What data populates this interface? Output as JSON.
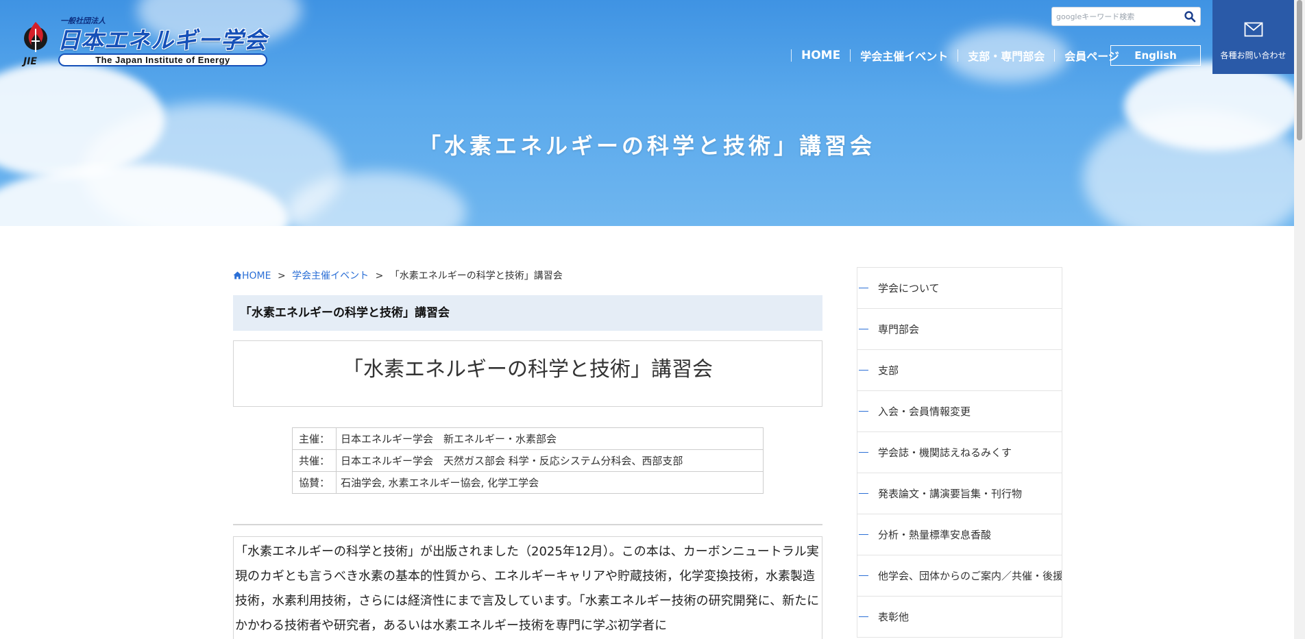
{
  "header": {
    "logo": {
      "small_label": "一般社団法人",
      "name_ja": "日本エネルギー学会",
      "name_en": "The Japan Institute of Energy",
      "mark_label": "JIE"
    },
    "search": {
      "placeholder": "googleキーワード検索"
    },
    "nav": [
      {
        "label": "HOME"
      },
      {
        "label": "学会主催イベント"
      },
      {
        "label": "支部・専門部会"
      },
      {
        "label": "会員ページ"
      }
    ],
    "english_label": "English",
    "contact_label": "各種お問い合わせ"
  },
  "hero": {
    "title": "「水素エネルギーの科学と技術」講習会"
  },
  "breadcrumb": {
    "home": "HOME",
    "separator": ">",
    "events": "学会主催イベント",
    "current": "「水素エネルギーの科学と技術」講習会"
  },
  "main": {
    "title_bar": "「水素エネルギーの科学と技術」講習会",
    "heading": "「水素エネルギーの科学と技術」講習会",
    "info": [
      {
        "key": "主催：",
        "value": "日本エネルギー学会　新エネルギー・水素部会"
      },
      {
        "key": "共催：",
        "value": "日本エネルギー学会　天然ガス部会 科学・反応システム分科会、西部支部"
      },
      {
        "key": "協賛：",
        "value": "石油学会, 水素エネルギー協会, 化学工学会"
      }
    ],
    "body": "「水素エネルギーの科学と技術」が出版されました（2025年12月）。この本は、カーボンニュートラル実現のカギとも言うべき水素の基本的性質から、エネルギーキャリアや貯蔵技術，化学変換技術，水素製造技術，水素利用技術，さらには経済性にまで言及しています。「水素エネルギー技術の研究開発に、新たにかかわる技術者や研究者，あるいは水素エネルギー技術を専門に学ぶ初学者に"
  },
  "sidebar": {
    "items": [
      {
        "label": "学会について"
      },
      {
        "label": "専門部会"
      },
      {
        "label": "支部"
      },
      {
        "label": "入会・会員情報変更"
      },
      {
        "label": "学会誌・機関誌えねるみくす"
      },
      {
        "label": "発表論文・講演要旨集・刊行物"
      },
      {
        "label": "分析・熱量標準安息香酸"
      },
      {
        "label": "他学会、団体からのご案内／共催・後援"
      },
      {
        "label": "表彰他"
      }
    ]
  },
  "colors": {
    "accent": "#2b6fd6",
    "contact_bg": "#2a5aa8",
    "title_bar_bg": "#e5edf6",
    "hero_sky": "#5aa9ec"
  }
}
